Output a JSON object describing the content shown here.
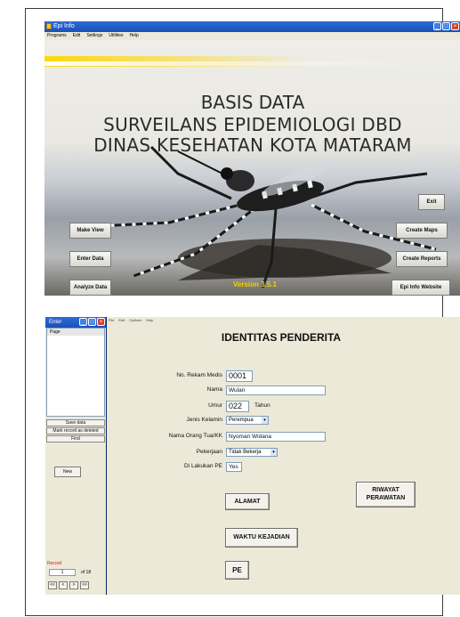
{
  "epi_info": {
    "window_title": "Epi Info",
    "menu": [
      "Programs",
      "Edit",
      "Settings",
      "Utilities",
      "Help"
    ],
    "heading_line1": "BASIS DATA",
    "heading_line2": "SURVEILANS EPIDEMIOLOGI DBD",
    "heading_line3": "DINAS KESEHATAN  KOTA MATARAM",
    "buttons": {
      "make_view": "Make View",
      "enter_data": "Enter Data",
      "analyze_data": "Analyze Data",
      "exit": "Exit",
      "create_maps": "Create Maps",
      "create_reports": "Create Reports",
      "website": "Epi Info Website"
    },
    "version": "Version 3.5.1"
  },
  "enter_form": {
    "window_title": "Enter",
    "menu": [
      "File",
      "Edit",
      "Options",
      "Help"
    ],
    "page_item": "Page",
    "side_buttons": {
      "save": "Save data",
      "mark_deleted": "Mark record as deleted",
      "find": "Find",
      "new": "New"
    },
    "record": {
      "label": "Record",
      "current": "1",
      "of_total": "of 18"
    },
    "nav": [
      "<<",
      "<",
      ">",
      ">>"
    ],
    "title": "IDENTITAS PENDERITA",
    "fields": {
      "rekam_medis": {
        "label": "No. Rekam Medis",
        "value": "0001"
      },
      "nama": {
        "label": "Nama",
        "value": "Wulan"
      },
      "umur": {
        "label": "Umur",
        "value": "022",
        "unit": "Tahun"
      },
      "jenis_kelamin": {
        "label": "Jenis Kelamin",
        "value": "Perempua"
      },
      "orang_tua": {
        "label": "Nama Orang Tua/KK",
        "value": "Nyoman Widana"
      },
      "pekerjaan": {
        "label": "Pekerjaan",
        "value": "Tidak Bekerja"
      },
      "di_lakukan_pe": {
        "label": "Di Lakukan PE",
        "value": "Yes"
      }
    },
    "buttons": {
      "alamat": "ALAMAT",
      "riwayat_line1": "RIWAYAT",
      "riwayat_line2": "PERAWATAN",
      "waktu": "WAKTU KEJADIAN",
      "pe": "PE"
    }
  },
  "colors": {
    "titlebar": "#1b4fb8",
    "close_button": "#d9412b",
    "version_text": "#f2d200",
    "record_label": "#c02020"
  }
}
